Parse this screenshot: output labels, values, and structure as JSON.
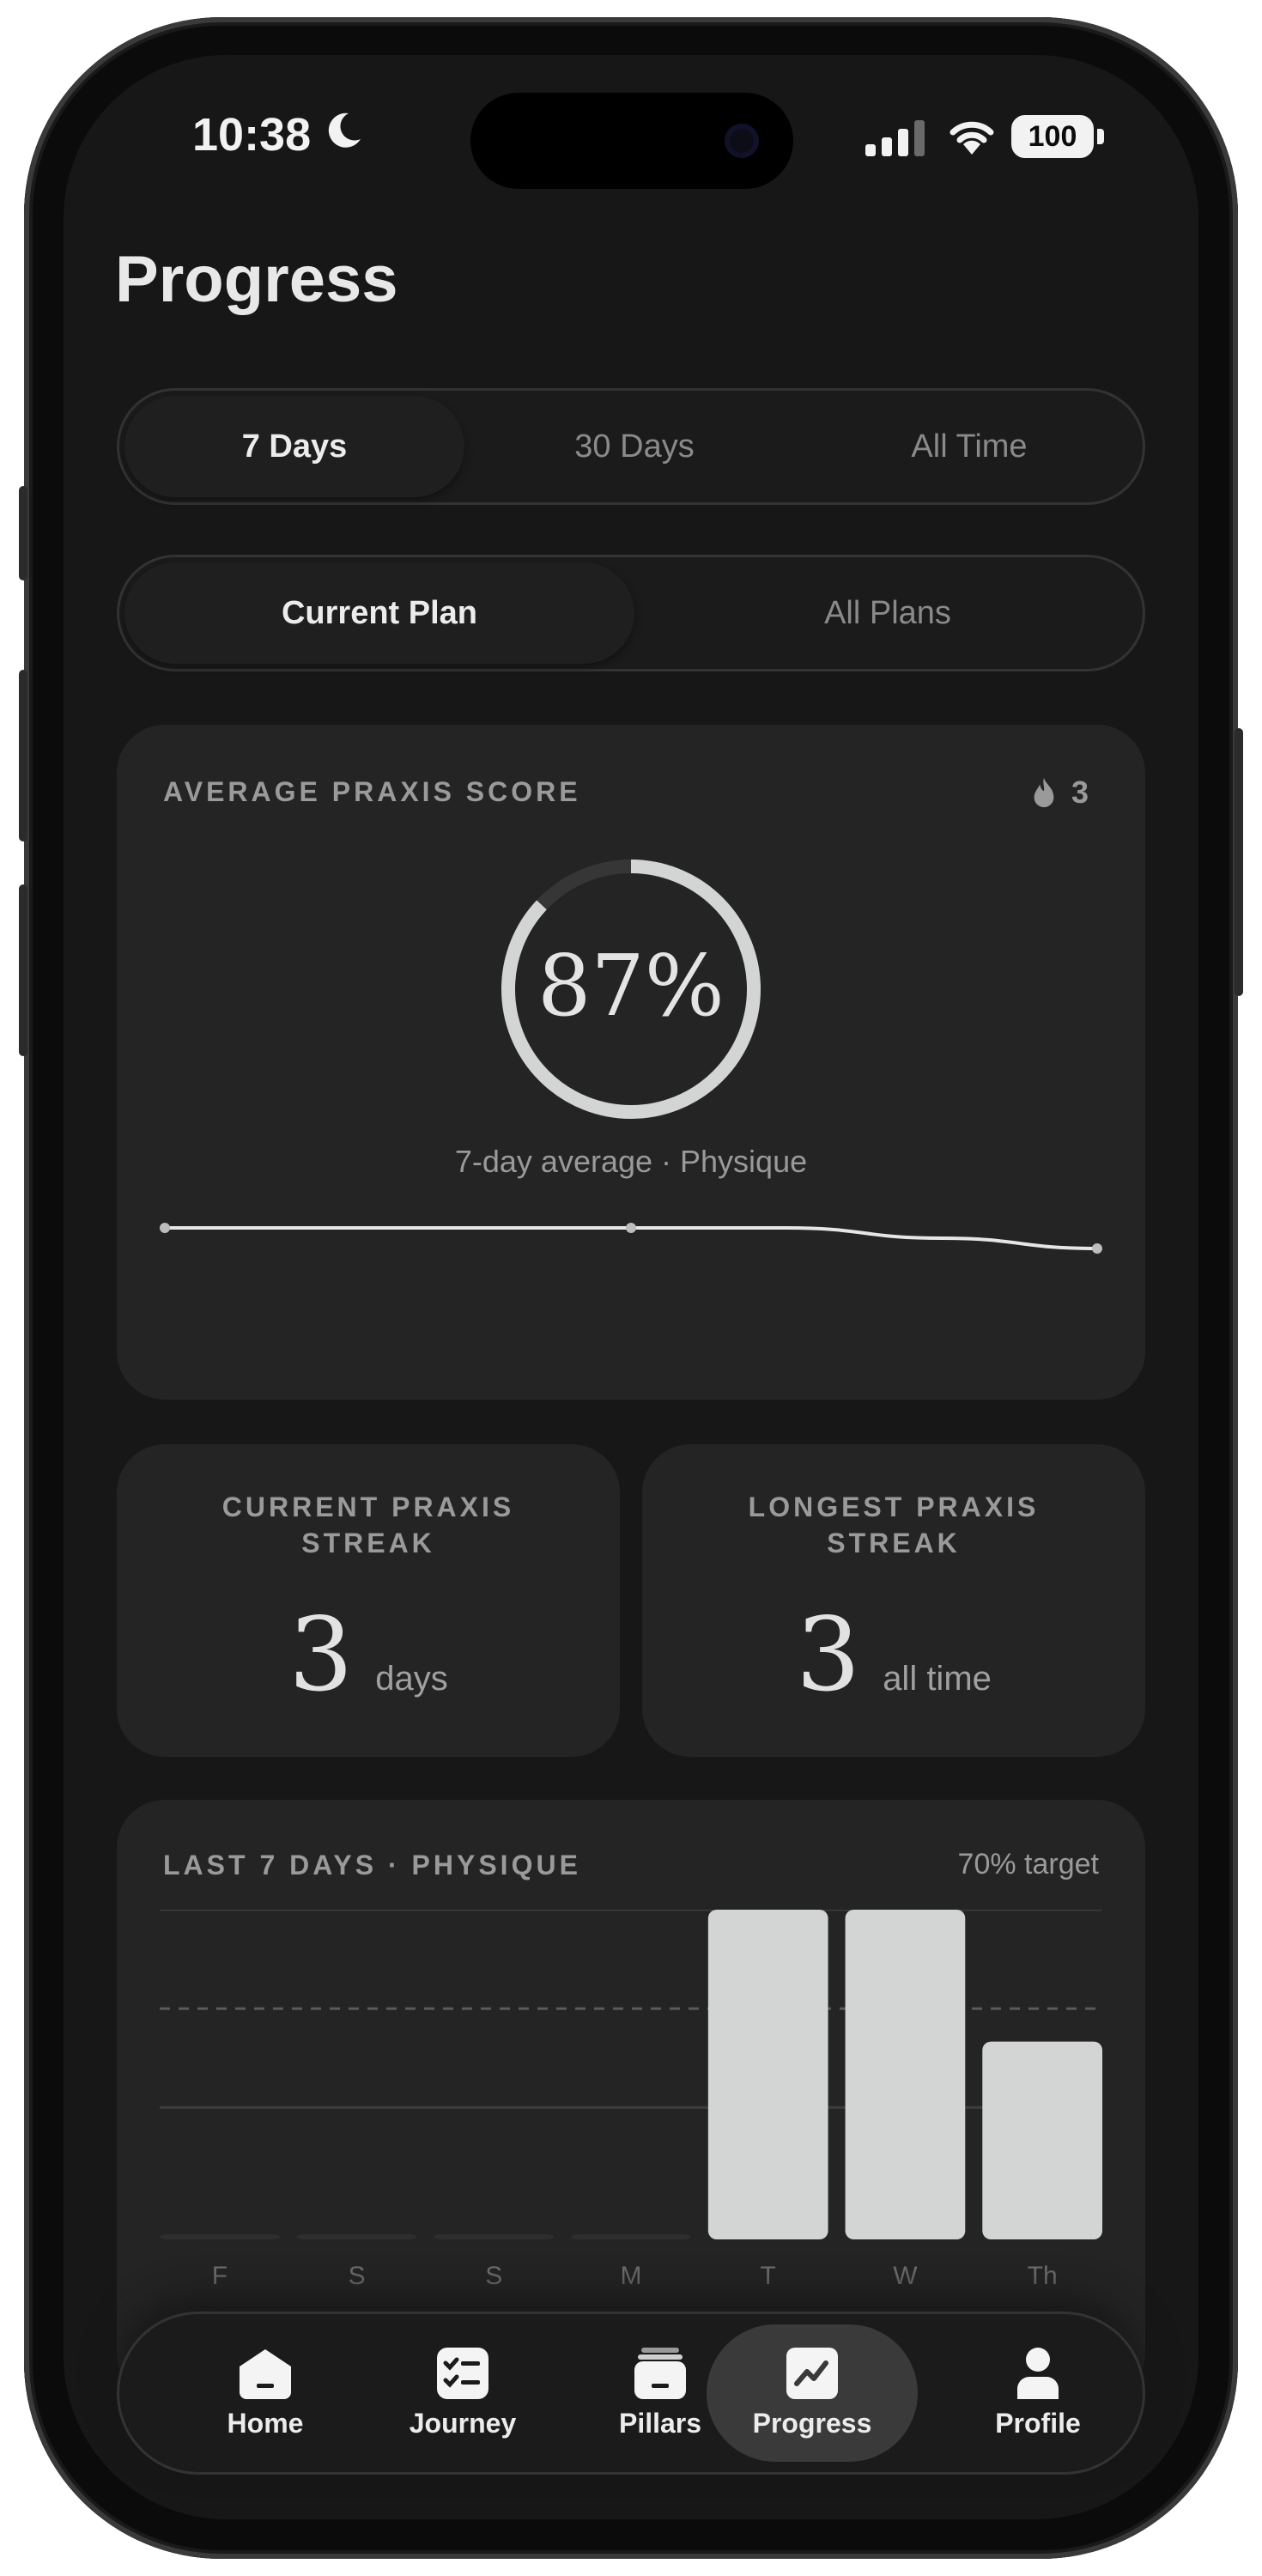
{
  "status_bar": {
    "time": "10:38",
    "battery": "100"
  },
  "page": {
    "title": "Progress"
  },
  "time_range": {
    "options": [
      "7 Days",
      "30 Days",
      "All Time"
    ],
    "selected": "7 Days"
  },
  "plan_scope": {
    "options": [
      "Current Plan",
      "All Plans"
    ],
    "selected": "Current Plan"
  },
  "score_card": {
    "label": "AVERAGE PRAXIS SCORE",
    "streak_count": "3",
    "score": "87%",
    "score_value": 0.87,
    "subtitle": "7-day average · Physique",
    "trend_points": [
      90,
      90,
      90,
      90,
      90,
      86,
      82
    ]
  },
  "streaks": {
    "current": {
      "label": "CURRENT PRAXIS STREAK",
      "value": "3",
      "unit": "days"
    },
    "longest": {
      "label": "LONGEST PRAXIS STREAK",
      "value": "3",
      "unit": "all time"
    }
  },
  "chart_data": {
    "type": "bar",
    "title": "LAST 7 DAYS · PHYSIQUE",
    "annotation": "70% target",
    "categories": [
      "F",
      "S",
      "S",
      "M",
      "T",
      "W",
      "Th"
    ],
    "values": [
      0,
      0,
      0,
      0,
      100,
      100,
      60
    ],
    "target": 70,
    "ylim": [
      0,
      100
    ],
    "grid": true
  },
  "nav": {
    "items": [
      {
        "label": "Home",
        "icon": "home-icon"
      },
      {
        "label": "Journey",
        "icon": "checklist-icon"
      },
      {
        "label": "Pillars",
        "icon": "pillars-icon"
      },
      {
        "label": "Progress",
        "icon": "trend-icon"
      },
      {
        "label": "Profile",
        "icon": "person-icon"
      }
    ],
    "active": "Progress"
  },
  "colors": {
    "background": "#171717",
    "card": "#242424",
    "accent": "#d3d4d4",
    "muted": "#9a9a9a"
  }
}
